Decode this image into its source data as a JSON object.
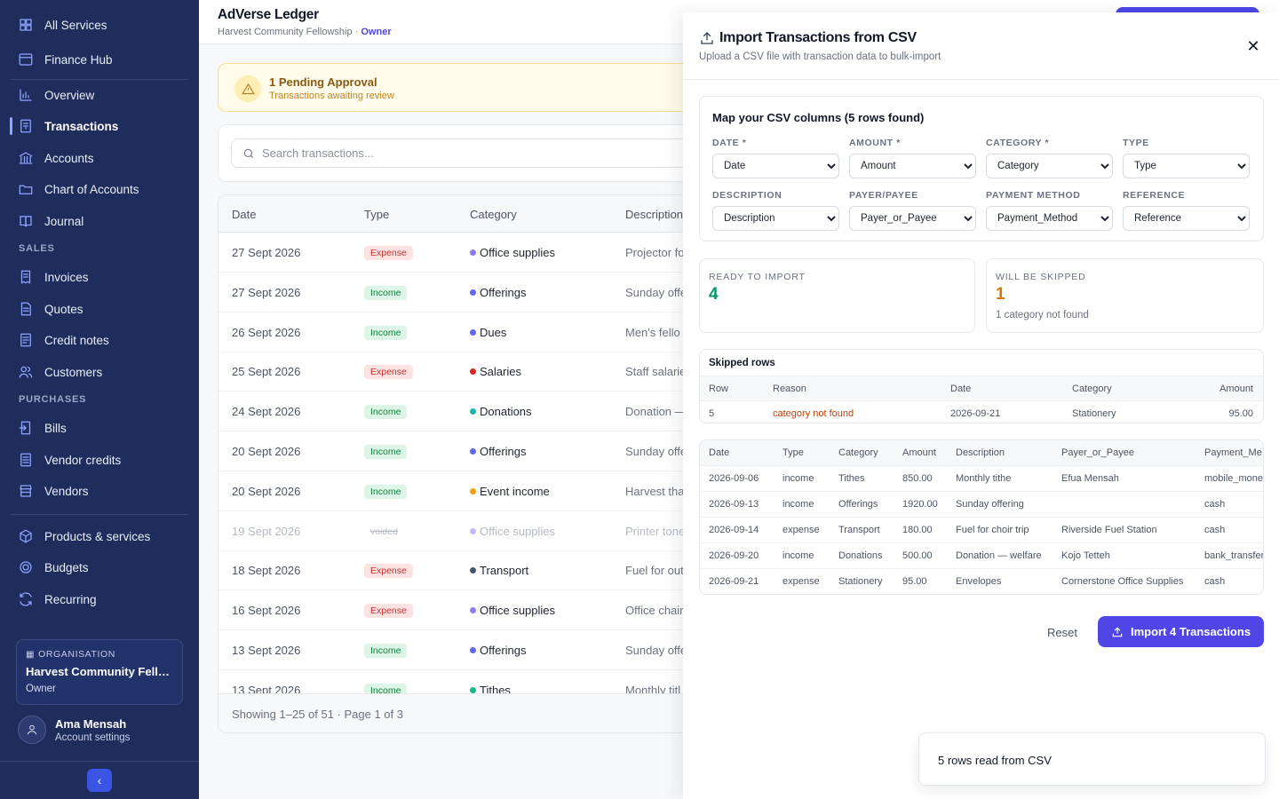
{
  "sidebar": {
    "top_items": [
      {
        "label": "All Services",
        "icon": "grid-icon"
      },
      {
        "label": "Finance Hub",
        "icon": "window-icon"
      }
    ],
    "main_items": [
      {
        "label": "Overview",
        "icon": "bar-chart-icon"
      },
      {
        "label": "Transactions",
        "icon": "receipt-icon",
        "active": true
      },
      {
        "label": "Accounts",
        "icon": "bank-icon"
      },
      {
        "label": "Chart of Accounts",
        "icon": "folder-icon"
      },
      {
        "label": "Journal",
        "icon": "book-icon"
      }
    ],
    "sales_label": "SALES",
    "sales_items": [
      {
        "label": "Invoices",
        "icon": "invoice-icon"
      },
      {
        "label": "Quotes",
        "icon": "document-icon"
      },
      {
        "label": "Credit notes",
        "icon": "credit-note-icon"
      },
      {
        "label": "Customers",
        "icon": "users-icon"
      }
    ],
    "purchases_label": "PURCHASES",
    "purchase_items": [
      {
        "label": "Bills",
        "icon": "bill-icon"
      },
      {
        "label": "Vendor credits",
        "icon": "vendor-credit-icon"
      },
      {
        "label": "Vendors",
        "icon": "store-icon"
      }
    ],
    "other_items": [
      {
        "label": "Products & services",
        "icon": "box-icon"
      },
      {
        "label": "Budgets",
        "icon": "target-icon"
      },
      {
        "label": "Recurring",
        "icon": "refresh-icon"
      }
    ],
    "organisation": {
      "label": "ORGANISATION",
      "name": "Harvest Community Fello...",
      "role": "Owner"
    },
    "user": {
      "name": "Ama Mensah",
      "sub": "Account settings"
    },
    "collapse_glyph": "‹"
  },
  "header": {
    "title": "AdVerse Ledger",
    "org": "Harvest Community Fellowship · ",
    "role": "Owner"
  },
  "pending": {
    "title": "1 Pending Approval",
    "subtitle": "Transactions awaiting review"
  },
  "search": {
    "placeholder": "Search transactions..."
  },
  "transactions": {
    "columns": [
      "Date",
      "Type",
      "Category",
      "Description"
    ],
    "rows": [
      {
        "date": "27 Sept 2026",
        "type": "Expense",
        "category": "Office supplies",
        "dot": "#8b7cf6",
        "desc": "Projector fo"
      },
      {
        "date": "27 Sept 2026",
        "type": "Income",
        "category": "Offerings",
        "dot": "#6366f1",
        "desc": "Sunday offe"
      },
      {
        "date": "26 Sept 2026",
        "type": "Income",
        "category": "Dues",
        "dot": "#6366f1",
        "desc": "Men's fello"
      },
      {
        "date": "25 Sept 2026",
        "type": "Expense",
        "category": "Salaries",
        "dot": "#dc2626",
        "desc": "Staff salarie"
      },
      {
        "date": "24 Sept 2026",
        "type": "Income",
        "category": "Donations",
        "dot": "#14b8a6",
        "desc": "Donation —"
      },
      {
        "date": "20 Sept 2026",
        "type": "Income",
        "category": "Offerings",
        "dot": "#6366f1",
        "desc": "Sunday offe"
      },
      {
        "date": "20 Sept 2026",
        "type": "Income",
        "category": "Event income",
        "dot": "#f59e0b",
        "desc": "Harvest tha"
      },
      {
        "date": "19 Sept 2026",
        "type": "voided",
        "category": "Office supplies",
        "dot": "#c4b5fd",
        "desc": "Printer tone",
        "voided": true
      },
      {
        "date": "18 Sept 2026",
        "type": "Expense",
        "category": "Transport",
        "dot": "#475569",
        "desc": "Fuel for out"
      },
      {
        "date": "16 Sept 2026",
        "type": "Expense",
        "category": "Office supplies",
        "dot": "#8b7cf6",
        "desc": "Office chair"
      },
      {
        "date": "13 Sept 2026",
        "type": "Income",
        "category": "Offerings",
        "dot": "#6366f1",
        "desc": "Sunday offe"
      },
      {
        "date": "13 Sept 2026",
        "type": "Income",
        "category": "Tithes",
        "dot": "#10b981",
        "desc": "Monthly titl"
      }
    ],
    "footer": "Showing 1–25 of 51 · Page 1 of 3"
  },
  "modal": {
    "title": "Import Transactions from CSV",
    "subtitle": "Upload a CSV file with transaction data to bulk-import",
    "close_glyph": "✕",
    "mapping": {
      "title": "Map your CSV columns (5 rows found)",
      "fields": [
        {
          "label": "DATE *",
          "value": "Date"
        },
        {
          "label": "AMOUNT *",
          "value": "Amount"
        },
        {
          "label": "CATEGORY *",
          "value": "Category"
        },
        {
          "label": "TYPE",
          "value": "Type"
        },
        {
          "label": "DESCRIPTION",
          "value": "Description"
        },
        {
          "label": "PAYER/PAYEE",
          "value": "Payer_or_Payee"
        },
        {
          "label": "PAYMENT METHOD",
          "value": "Payment_Method"
        },
        {
          "label": "REFERENCE",
          "value": "Reference"
        }
      ]
    },
    "ready": {
      "label": "READY TO IMPORT",
      "value": "4",
      "color": "#059669"
    },
    "skipped": {
      "label": "WILL BE SKIPPED",
      "value": "1",
      "note": "1 category not found",
      "color": "#d97706"
    },
    "skipped_rows": {
      "title": "Skipped rows",
      "columns": [
        "Row",
        "Reason",
        "Date",
        "Category",
        "Amount"
      ],
      "rows": [
        {
          "row": "5",
          "reason": "category not found",
          "date": "2026-09-21",
          "category": "Stationery",
          "amount": "95.00"
        }
      ]
    },
    "preview": {
      "columns": [
        "Date",
        "Type",
        "Category",
        "Amount",
        "Description",
        "Payer_or_Payee",
        "Payment_Me"
      ],
      "rows": [
        [
          "2026-09-06",
          "income",
          "Tithes",
          "850.00",
          "Monthly tithe",
          "Efua Mensah",
          "mobile_mone"
        ],
        [
          "2026-09-13",
          "income",
          "Offerings",
          "1920.00",
          "Sunday offering",
          "",
          "cash"
        ],
        [
          "2026-09-14",
          "expense",
          "Transport",
          "180.00",
          "Fuel for choir trip",
          "Riverside Fuel Station",
          "cash"
        ],
        [
          "2026-09-20",
          "income",
          "Donations",
          "500.00",
          "Donation — welfare",
          "Kojo Tetteh",
          "bank_transfer"
        ],
        [
          "2026-09-21",
          "expense",
          "Stationery",
          "95.00",
          "Envelopes",
          "Cornerstone Office Supplies",
          "cash"
        ]
      ]
    },
    "reset_label": "Reset",
    "import_label": "Import 4 Transactions"
  },
  "toast": {
    "message": "5 rows read from CSV"
  }
}
